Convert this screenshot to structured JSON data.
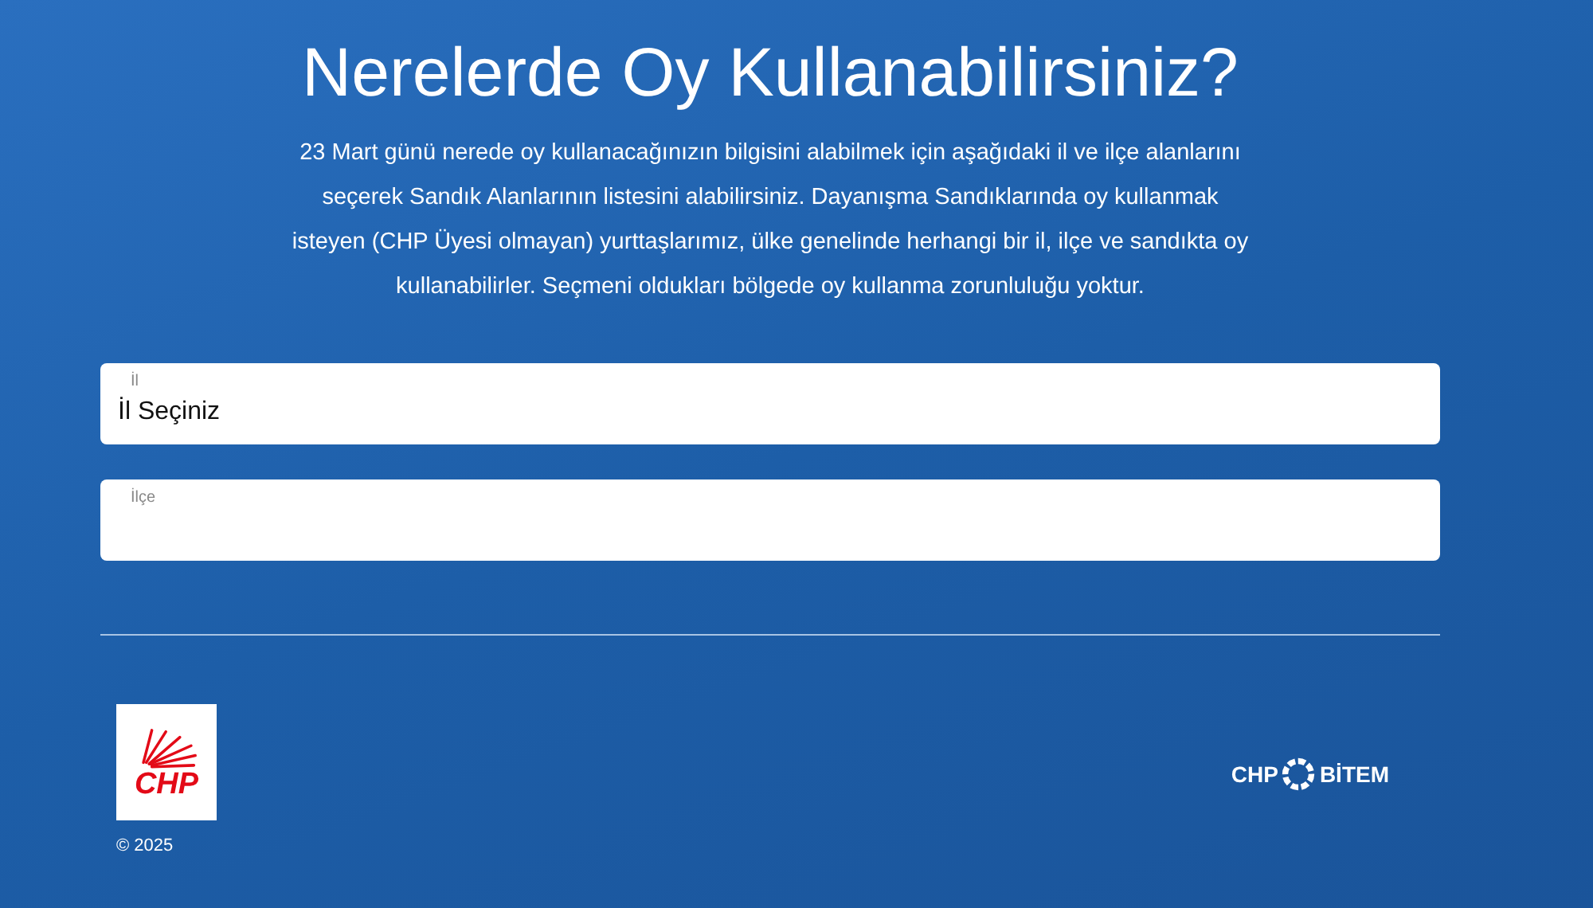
{
  "heading": "Nerelerde Oy Kullanabilirsiniz?",
  "intro": "23 Mart günü nerede oy kullanacağınızın bilgisini alabilmek için aşağıdaki il ve ilçe alanlarını seçerek Sandık Alanlarının listesini alabilirsiniz. Dayanışma Sandıklarında oy kullanmak isteyen (CHP Üyesi olmayan) yurttaşlarımız, ülke genelinde herhangi bir il, ilçe ve sandıkta oy kullanabilirler. Seçmeni oldukları bölgede oy kullanma zorunluluğu yoktur.",
  "fields": [
    {
      "label": "İl",
      "value": "İl Seçiniz"
    },
    {
      "label": "İlçe"
    }
  ],
  "footer": {
    "party_logo": "CHP",
    "copyright": "© 2025",
    "partner_logo": {
      "left": "CHP",
      "right": "BİTEM"
    }
  }
}
